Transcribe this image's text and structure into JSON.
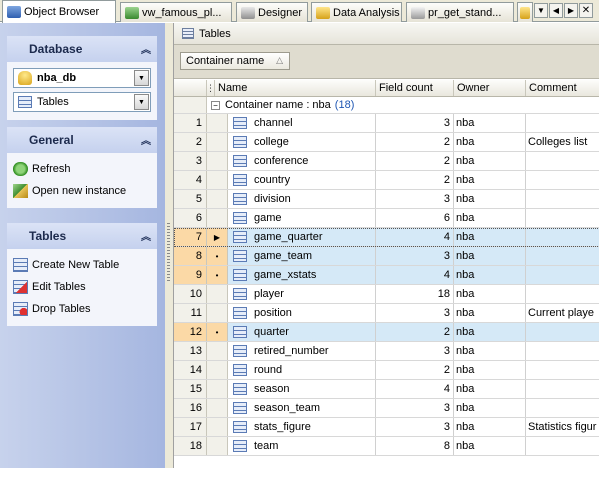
{
  "tabs": [
    {
      "label": "Object Browser",
      "icon": "object-browser-icon",
      "active": true
    },
    {
      "label": "vw_famous_pl...",
      "icon": "view-icon",
      "active": false
    },
    {
      "label": "Designer",
      "icon": "designer-icon",
      "active": false
    },
    {
      "label": "Data Analysis",
      "icon": "data-analysis-icon",
      "active": false
    },
    {
      "label": "pr_get_stand...",
      "icon": "procedure-icon",
      "active": false
    }
  ],
  "sidebar": {
    "database": {
      "title": "Database",
      "db_value": "nba_db",
      "type_value": "Tables"
    },
    "general": {
      "title": "General",
      "items": [
        {
          "label": "Refresh",
          "icon": "refresh-icon"
        },
        {
          "label": "Open new instance",
          "icon": "open-instance-icon"
        }
      ]
    },
    "tables": {
      "title": "Tables",
      "items": [
        {
          "label": "Create New Table",
          "icon": "create-table-icon"
        },
        {
          "label": "Edit Tables",
          "icon": "edit-tables-icon"
        },
        {
          "label": "Drop Tables",
          "icon": "drop-tables-icon"
        }
      ]
    }
  },
  "main": {
    "header_title": "Tables",
    "group_by_chip": "Container name",
    "columns": [
      "Name",
      "Field count",
      "Owner",
      "Comment"
    ],
    "group_label": "Container name : nba",
    "group_count": "(18)",
    "rows": [
      {
        "num": "1",
        "name": "channel",
        "fields": "3",
        "owner": "nba",
        "comment": ""
      },
      {
        "num": "2",
        "name": "college",
        "fields": "2",
        "owner": "nba",
        "comment": "Colleges list"
      },
      {
        "num": "3",
        "name": "conference",
        "fields": "2",
        "owner": "nba",
        "comment": ""
      },
      {
        "num": "4",
        "name": "country",
        "fields": "2",
        "owner": "nba",
        "comment": ""
      },
      {
        "num": "5",
        "name": "division",
        "fields": "3",
        "owner": "nba",
        "comment": ""
      },
      {
        "num": "6",
        "name": "game",
        "fields": "6",
        "owner": "nba",
        "comment": ""
      },
      {
        "num": "7",
        "name": "game_quarter",
        "fields": "4",
        "owner": "nba",
        "comment": ""
      },
      {
        "num": "8",
        "name": "game_team",
        "fields": "3",
        "owner": "nba",
        "comment": ""
      },
      {
        "num": "9",
        "name": "game_xstats",
        "fields": "4",
        "owner": "nba",
        "comment": ""
      },
      {
        "num": "10",
        "name": "player",
        "fields": "18",
        "owner": "nba",
        "comment": ""
      },
      {
        "num": "11",
        "name": "position",
        "fields": "3",
        "owner": "nba",
        "comment": "Current playe"
      },
      {
        "num": "12",
        "name": "quarter",
        "fields": "2",
        "owner": "nba",
        "comment": ""
      },
      {
        "num": "13",
        "name": "retired_number",
        "fields": "3",
        "owner": "nba",
        "comment": ""
      },
      {
        "num": "14",
        "name": "round",
        "fields": "2",
        "owner": "nba",
        "comment": ""
      },
      {
        "num": "15",
        "name": "season",
        "fields": "4",
        "owner": "nba",
        "comment": ""
      },
      {
        "num": "16",
        "name": "season_team",
        "fields": "3",
        "owner": "nba",
        "comment": ""
      },
      {
        "num": "17",
        "name": "stats_figure",
        "fields": "3",
        "owner": "nba",
        "comment": "Statistics figur"
      },
      {
        "num": "18",
        "name": "team",
        "fields": "8",
        "owner": "nba",
        "comment": ""
      }
    ],
    "selected_rows": [
      "7",
      "8",
      "9",
      "12"
    ],
    "focused_row": "7"
  },
  "colors": {
    "selection": "#d5e9f7",
    "selected_indicator": "#fbd9a6",
    "sidebar_gradient": "#a5b6e0",
    "accent": "#1f57b3"
  }
}
